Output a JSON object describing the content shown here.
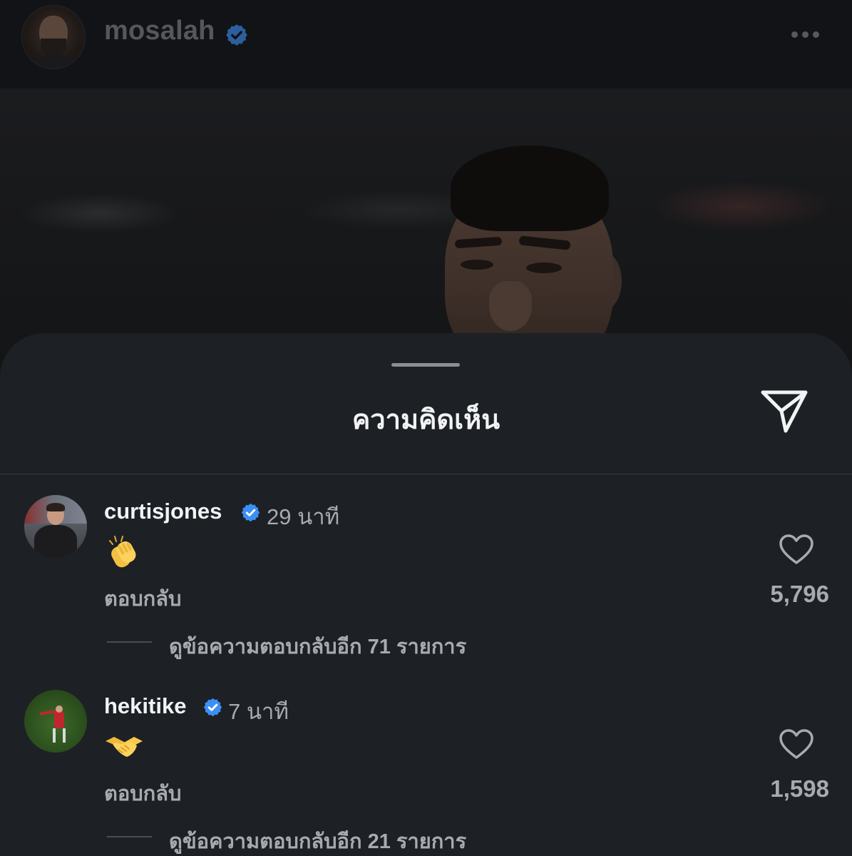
{
  "post": {
    "username": "mosalah"
  },
  "sheet": {
    "title": "ความคิดเห็น"
  },
  "comments": [
    {
      "username": "curtisjones",
      "time": "29 นาที",
      "emoji": "clapping-hands",
      "reply_label": "ตอบกลับ",
      "likes": "5,796",
      "view_replies": "ดูข้อความตอบกลับอีก 71 รายการ"
    },
    {
      "username": "hekitike",
      "time": "7 นาที",
      "emoji": "handshake",
      "reply_label": "ตอบกลับ",
      "likes": "1,598",
      "view_replies": "ดูข้อความตอบกลับอีก 21 รายการ"
    }
  ],
  "icons": {
    "verified": "verified-badge-icon",
    "more": "more-options-icon",
    "send": "send-icon",
    "like": "heart-icon"
  },
  "colors": {
    "verified": "#3b8ff5",
    "sheet_bg": "#1d2024",
    "text_primary": "#f2f3f5",
    "text_secondary": "#a7abb1"
  }
}
